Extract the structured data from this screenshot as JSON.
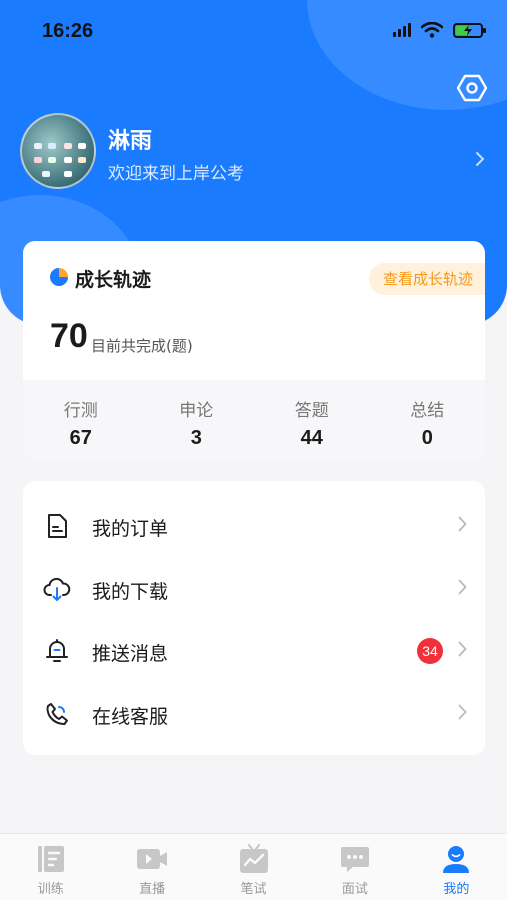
{
  "status_bar": {
    "time": "16:26"
  },
  "profile": {
    "name": "淋雨",
    "welcome": "欢迎来到上岸公考"
  },
  "growth": {
    "title": "成长轨迹",
    "link_label": "查看成长轨迹",
    "total_count": "70",
    "total_label": "目前共完成(题)",
    "stats": [
      {
        "label": "行测",
        "value": "67"
      },
      {
        "label": "申论",
        "value": "3"
      },
      {
        "label": "答题",
        "value": "44"
      },
      {
        "label": "总结",
        "value": "0"
      }
    ]
  },
  "menu": {
    "items": [
      {
        "label": "我的订单",
        "icon": "order-icon"
      },
      {
        "label": "我的下载",
        "icon": "cloud-download-icon"
      },
      {
        "label": "推送消息",
        "icon": "bell-icon",
        "badge": "34"
      },
      {
        "label": "在线客服",
        "icon": "phone-icon"
      }
    ]
  },
  "tabbar": {
    "items": [
      {
        "label": "训练",
        "icon": "training-icon"
      },
      {
        "label": "直播",
        "icon": "live-icon"
      },
      {
        "label": "笔试",
        "icon": "written-exam-icon"
      },
      {
        "label": "面试",
        "icon": "interview-icon"
      },
      {
        "label": "我的",
        "icon": "profile-icon",
        "active": true
      }
    ]
  },
  "colors": {
    "primary": "#1a7bff",
    "badge": "#f0313b",
    "accent_orange": "#f39a1c",
    "accent_orange_bg": "#fff1dc"
  }
}
